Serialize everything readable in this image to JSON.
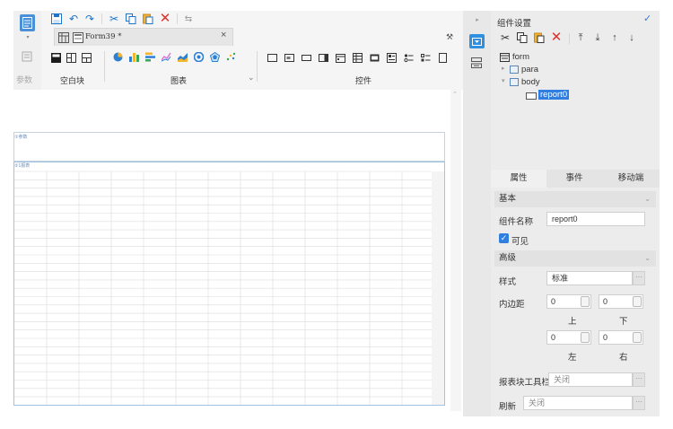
{
  "toolbar": {
    "tab_label": "Form39 *",
    "tab_close": "×",
    "param_label": "参数",
    "blank_label": "空白块",
    "chart_label": "图表",
    "widget_label": "控件",
    "dropdown_glyph": "⌄"
  },
  "canvas": {
    "para_tag": "①参数",
    "body_tag": "②1报表"
  },
  "panel": {
    "title": "组件设置",
    "check": "✓",
    "tree": [
      {
        "label": "form"
      },
      {
        "label": "para"
      },
      {
        "label": "body"
      },
      {
        "label": "report0"
      }
    ],
    "tabs": [
      "属性",
      "事件",
      "移动端"
    ],
    "basic_section": "基本",
    "name_label": "组件名称",
    "name_value": "report0",
    "visible_label": "可见",
    "advanced_section": "高级",
    "style_label": "样式",
    "style_value": "标准",
    "padding_label": "内边距",
    "pad_top": "0",
    "pad_bottom": "0",
    "pad_left": "0",
    "pad_right": "0",
    "top_label": "上",
    "bottom_label": "下",
    "left_label": "左",
    "right_label": "右",
    "toolbar_label": "报表块工具栏",
    "toolbar_value": "关闭",
    "refresh_label": "刷新",
    "refresh_value": "关闭",
    "dots": "···"
  },
  "colors": {
    "accent": "#1e74c8",
    "delete": "#e0312c",
    "selection": "#2f7ee0"
  }
}
